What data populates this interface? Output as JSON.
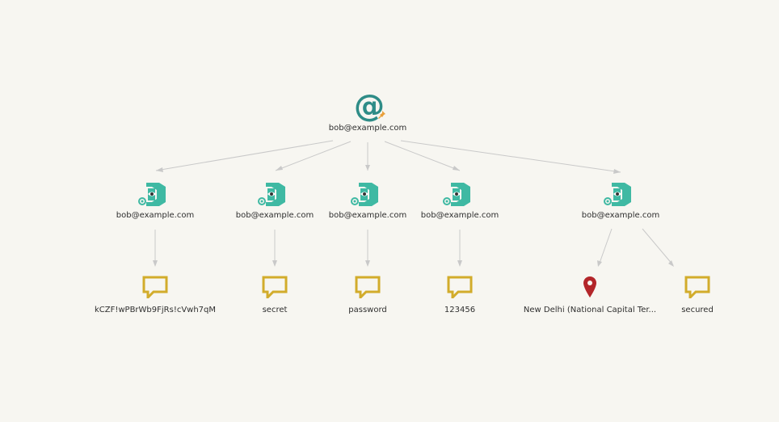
{
  "root": {
    "label": "bob@example.com",
    "icon": "at-sign-icon",
    "badge": "pin-icon",
    "color": "#2e8c87",
    "badge_color": "#e8a03c"
  },
  "breaches": [
    {
      "label": "bob@example.com",
      "icon": "breach-database-icon"
    },
    {
      "label": "bob@example.com",
      "icon": "breach-database-icon"
    },
    {
      "label": "bob@example.com",
      "icon": "breach-database-icon"
    },
    {
      "label": "bob@example.com",
      "icon": "breach-database-icon"
    },
    {
      "label": "bob@example.com",
      "icon": "breach-database-icon"
    }
  ],
  "leaves": [
    {
      "label": "kCZF!wPBrWb9FjRs!cVwh7qM",
      "icon": "speech-bubble-icon"
    },
    {
      "label": "secret",
      "icon": "speech-bubble-icon"
    },
    {
      "label": "password",
      "icon": "speech-bubble-icon"
    },
    {
      "label": "123456",
      "icon": "speech-bubble-icon"
    },
    {
      "label": "New Delhi (National Capital Ter...",
      "icon": "map-pin-icon"
    },
    {
      "label": "secured",
      "icon": "speech-bubble-icon"
    }
  ],
  "colors": {
    "breach": "#3fb9a3",
    "phrase": "#d2ac2b",
    "location": "#b3262a",
    "edge": "#c9c9c9"
  }
}
